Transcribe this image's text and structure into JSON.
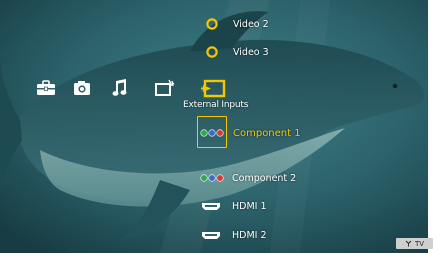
{
  "category_bar": {
    "items": [
      {
        "icon": "toolbox-icon"
      },
      {
        "icon": "camera-icon"
      },
      {
        "icon": "music-note-icon"
      },
      {
        "icon": "video-icon"
      },
      {
        "icon": "external-inputs-icon",
        "label": "External Inputs",
        "selected": true
      }
    ]
  },
  "input_list": {
    "items": [
      {
        "label": "Video 2",
        "icon": "composite-video-icon"
      },
      {
        "label": "Video 3",
        "icon": "composite-video-icon"
      },
      {
        "label": "Component 1",
        "icon": "component-rgb-icon",
        "selected": true
      },
      {
        "label": "Component 2",
        "icon": "component-rgb-icon"
      },
      {
        "label": "HDMI 1",
        "icon": "hdmi-port-icon"
      },
      {
        "label": "HDMI 2",
        "icon": "hdmi-port-icon"
      }
    ]
  },
  "status_badge": {
    "label": "TV",
    "icon": "antenna-icon"
  },
  "colors": {
    "accent": "#f4c700",
    "background_teal": "#2f6a73",
    "component_green": "#2fa84f",
    "component_blue": "#3a6cc8",
    "component_red": "#d23b3b"
  }
}
